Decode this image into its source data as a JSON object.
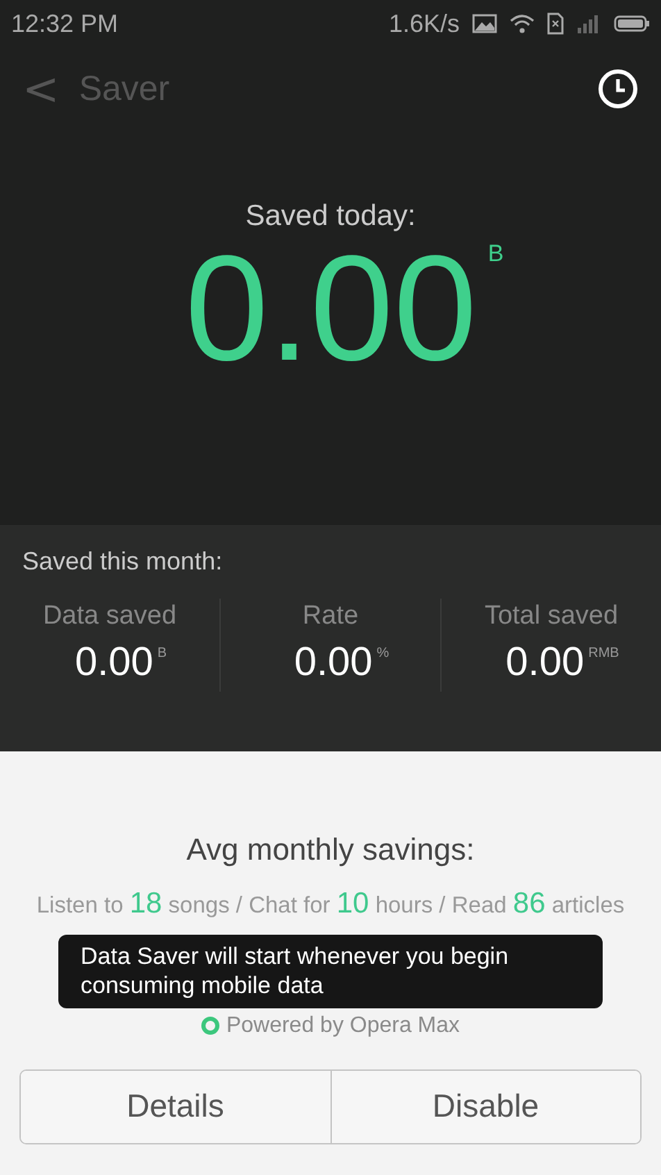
{
  "status_bar": {
    "time": "12:32 PM",
    "speed": "1.6K/s"
  },
  "header": {
    "back": "<",
    "title": "Saver"
  },
  "today": {
    "label": "Saved today:",
    "value": "0.00",
    "unit": "B"
  },
  "month": {
    "label": "Saved this month:",
    "stats": [
      {
        "label": "Data saved",
        "value": "0.00",
        "unit": "B"
      },
      {
        "label": "Rate",
        "value": "0.00",
        "unit": "%"
      },
      {
        "label": "Total saved",
        "value": "0.00",
        "unit": "RMB"
      }
    ]
  },
  "avg": {
    "title": "Avg monthly savings:",
    "parts": [
      {
        "kind": "text",
        "text": "Listen to"
      },
      {
        "kind": "number",
        "text": "18"
      },
      {
        "kind": "text",
        "text": "songs / Chat for"
      },
      {
        "kind": "number",
        "text": "10"
      },
      {
        "kind": "text",
        "text": "hours / Read"
      },
      {
        "kind": "number",
        "text": "86"
      },
      {
        "kind": "text",
        "text": "articles"
      }
    ]
  },
  "toast": "Data Saver will start whenever you begin consuming mobile data",
  "powered_by": "Powered by Opera Max",
  "buttons": [
    "Details",
    "Disable"
  ]
}
